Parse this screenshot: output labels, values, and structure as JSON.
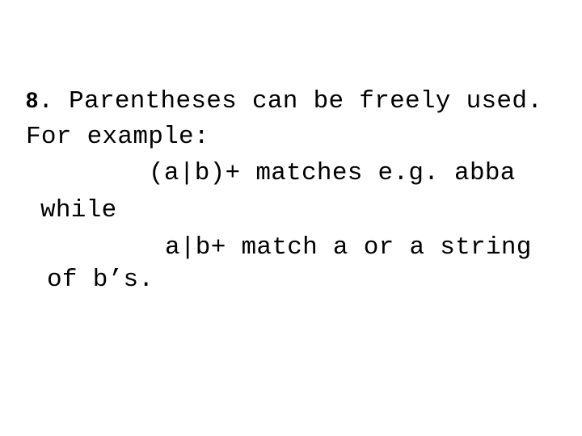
{
  "slide": {
    "item_number": "8",
    "lines": [
      ". Parentheses can be freely used.",
      "For example:",
      "(a|b)+ matches e.g. abba",
      "while",
      "a|b+ match a or a string",
      "of b’s."
    ]
  }
}
